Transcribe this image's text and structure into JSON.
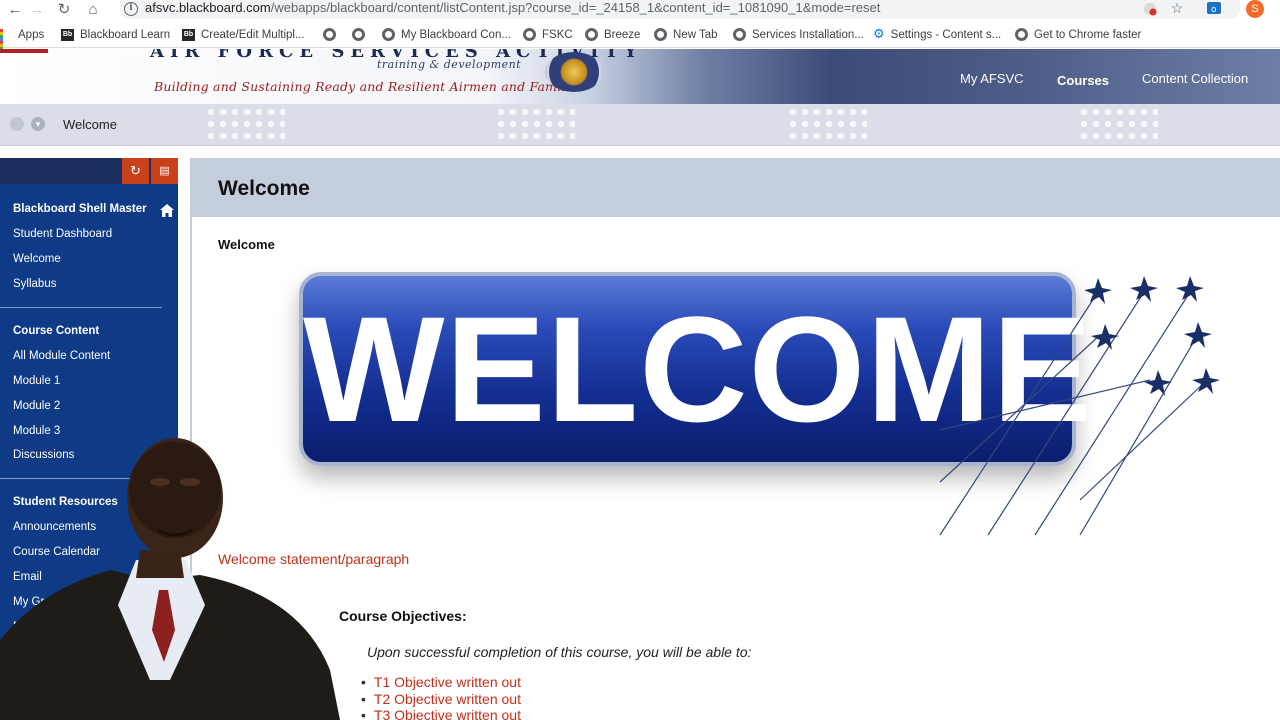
{
  "browser": {
    "url_host": "afsvc.blackboard.com",
    "url_path": "/webapps/blackboard/content/listContent.jsp?course_id=_24158_1&content_id=_1081090_1&mode=reset",
    "profile_initial": "S",
    "bookmarks": [
      {
        "label": "Apps",
        "icon": "apps-icon"
      },
      {
        "label": "Blackboard Learn",
        "icon": "blackboard-icon"
      },
      {
        "label": "Create/Edit Multipl...",
        "icon": "blackboard-icon"
      },
      {
        "label": "",
        "icon": "globe-icon"
      },
      {
        "label": "",
        "icon": "globe-icon"
      },
      {
        "label": "My Blackboard Con...",
        "icon": "globe-icon"
      },
      {
        "label": "FSKC",
        "icon": "globe-icon"
      },
      {
        "label": "Breeze",
        "icon": "globe-icon"
      },
      {
        "label": "New Tab",
        "icon": "globe-icon"
      },
      {
        "label": "Services Installation...",
        "icon": "globe-icon"
      },
      {
        "label": "Settings - Content s...",
        "icon": "gear-icon"
      },
      {
        "label": "Get to Chrome faster",
        "icon": "globe-icon"
      }
    ]
  },
  "banner": {
    "top_text": "AIR FORCE SERVICES ACTIVITY",
    "subtitle": "training & development",
    "motto": "Building and Sustaining Ready and Resilient Airmen and Families",
    "nav": [
      "My AFSVC",
      "Courses",
      "Content Collection"
    ],
    "active_nav": "Courses"
  },
  "breadcrumb": {
    "current": "Welcome"
  },
  "course_menu": {
    "course_title": "Blackboard Shell Master",
    "groups": [
      {
        "items": [
          "Student Dashboard",
          "Welcome",
          "Syllabus"
        ]
      },
      {
        "header": "Course Content",
        "items": [
          "All Module Content",
          "Module 1",
          "Module 2",
          "Module 3",
          "Discussions"
        ]
      },
      {
        "header": "Student Resources",
        "items": [
          "Announcements",
          "Course Calendar",
          "Email",
          "My Gr",
          "M"
        ]
      }
    ]
  },
  "content": {
    "page_title": "Welcome",
    "item_title": "Welcome",
    "banner_word": "WELCOME",
    "statement": "Welcome statement/paragraph",
    "objectives_title": "Course Objectives:",
    "objectives_intro": "Upon successful completion of this course, you will be able to:",
    "objectives": [
      "T1 Objective written out",
      "T2 Objective written out",
      "T3 Objective written out"
    ]
  },
  "colors": {
    "menu_bg": "#0e3a86",
    "accent_orange": "#c9411b",
    "link_red": "#c0311a",
    "header_band": "#c4cddc"
  }
}
